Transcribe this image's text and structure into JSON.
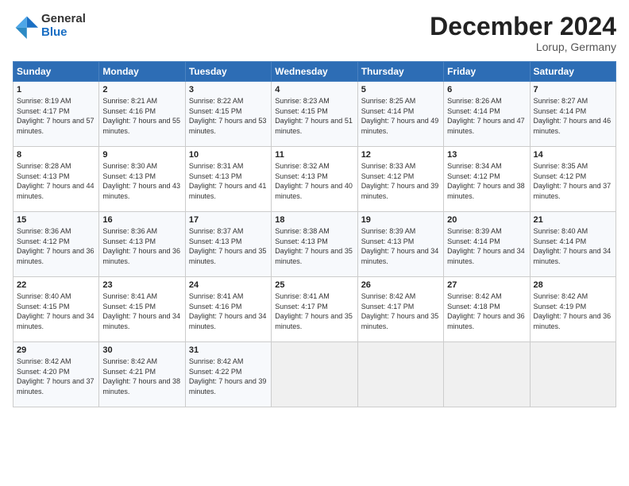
{
  "logo": {
    "general": "General",
    "blue": "Blue"
  },
  "header": {
    "month": "December 2024",
    "location": "Lorup, Germany"
  },
  "days": [
    "Sunday",
    "Monday",
    "Tuesday",
    "Wednesday",
    "Thursday",
    "Friday",
    "Saturday"
  ],
  "weeks": [
    [
      {
        "day": 1,
        "rise": "8:19 AM",
        "set": "4:17 PM",
        "daylight": "7 hours and 57 minutes."
      },
      {
        "day": 2,
        "rise": "8:21 AM",
        "set": "4:16 PM",
        "daylight": "7 hours and 55 minutes."
      },
      {
        "day": 3,
        "rise": "8:22 AM",
        "set": "4:15 PM",
        "daylight": "7 hours and 53 minutes."
      },
      {
        "day": 4,
        "rise": "8:23 AM",
        "set": "4:15 PM",
        "daylight": "7 hours and 51 minutes."
      },
      {
        "day": 5,
        "rise": "8:25 AM",
        "set": "4:14 PM",
        "daylight": "7 hours and 49 minutes."
      },
      {
        "day": 6,
        "rise": "8:26 AM",
        "set": "4:14 PM",
        "daylight": "7 hours and 47 minutes."
      },
      {
        "day": 7,
        "rise": "8:27 AM",
        "set": "4:14 PM",
        "daylight": "7 hours and 46 minutes."
      }
    ],
    [
      {
        "day": 8,
        "rise": "8:28 AM",
        "set": "4:13 PM",
        "daylight": "7 hours and 44 minutes."
      },
      {
        "day": 9,
        "rise": "8:30 AM",
        "set": "4:13 PM",
        "daylight": "7 hours and 43 minutes."
      },
      {
        "day": 10,
        "rise": "8:31 AM",
        "set": "4:13 PM",
        "daylight": "7 hours and 41 minutes."
      },
      {
        "day": 11,
        "rise": "8:32 AM",
        "set": "4:13 PM",
        "daylight": "7 hours and 40 minutes."
      },
      {
        "day": 12,
        "rise": "8:33 AM",
        "set": "4:12 PM",
        "daylight": "7 hours and 39 minutes."
      },
      {
        "day": 13,
        "rise": "8:34 AM",
        "set": "4:12 PM",
        "daylight": "7 hours and 38 minutes."
      },
      {
        "day": 14,
        "rise": "8:35 AM",
        "set": "4:12 PM",
        "daylight": "7 hours and 37 minutes."
      }
    ],
    [
      {
        "day": 15,
        "rise": "8:36 AM",
        "set": "4:12 PM",
        "daylight": "7 hours and 36 minutes."
      },
      {
        "day": 16,
        "rise": "8:36 AM",
        "set": "4:13 PM",
        "daylight": "7 hours and 36 minutes."
      },
      {
        "day": 17,
        "rise": "8:37 AM",
        "set": "4:13 PM",
        "daylight": "7 hours and 35 minutes."
      },
      {
        "day": 18,
        "rise": "8:38 AM",
        "set": "4:13 PM",
        "daylight": "7 hours and 35 minutes."
      },
      {
        "day": 19,
        "rise": "8:39 AM",
        "set": "4:13 PM",
        "daylight": "7 hours and 34 minutes."
      },
      {
        "day": 20,
        "rise": "8:39 AM",
        "set": "4:14 PM",
        "daylight": "7 hours and 34 minutes."
      },
      {
        "day": 21,
        "rise": "8:40 AM",
        "set": "4:14 PM",
        "daylight": "7 hours and 34 minutes."
      }
    ],
    [
      {
        "day": 22,
        "rise": "8:40 AM",
        "set": "4:15 PM",
        "daylight": "7 hours and 34 minutes."
      },
      {
        "day": 23,
        "rise": "8:41 AM",
        "set": "4:15 PM",
        "daylight": "7 hours and 34 minutes."
      },
      {
        "day": 24,
        "rise": "8:41 AM",
        "set": "4:16 PM",
        "daylight": "7 hours and 34 minutes."
      },
      {
        "day": 25,
        "rise": "8:41 AM",
        "set": "4:17 PM",
        "daylight": "7 hours and 35 minutes."
      },
      {
        "day": 26,
        "rise": "8:42 AM",
        "set": "4:17 PM",
        "daylight": "7 hours and 35 minutes."
      },
      {
        "day": 27,
        "rise": "8:42 AM",
        "set": "4:18 PM",
        "daylight": "7 hours and 36 minutes."
      },
      {
        "day": 28,
        "rise": "8:42 AM",
        "set": "4:19 PM",
        "daylight": "7 hours and 36 minutes."
      }
    ],
    [
      {
        "day": 29,
        "rise": "8:42 AM",
        "set": "4:20 PM",
        "daylight": "7 hours and 37 minutes."
      },
      {
        "day": 30,
        "rise": "8:42 AM",
        "set": "4:21 PM",
        "daylight": "7 hours and 38 minutes."
      },
      {
        "day": 31,
        "rise": "8:42 AM",
        "set": "4:22 PM",
        "daylight": "7 hours and 39 minutes."
      },
      null,
      null,
      null,
      null
    ]
  ]
}
